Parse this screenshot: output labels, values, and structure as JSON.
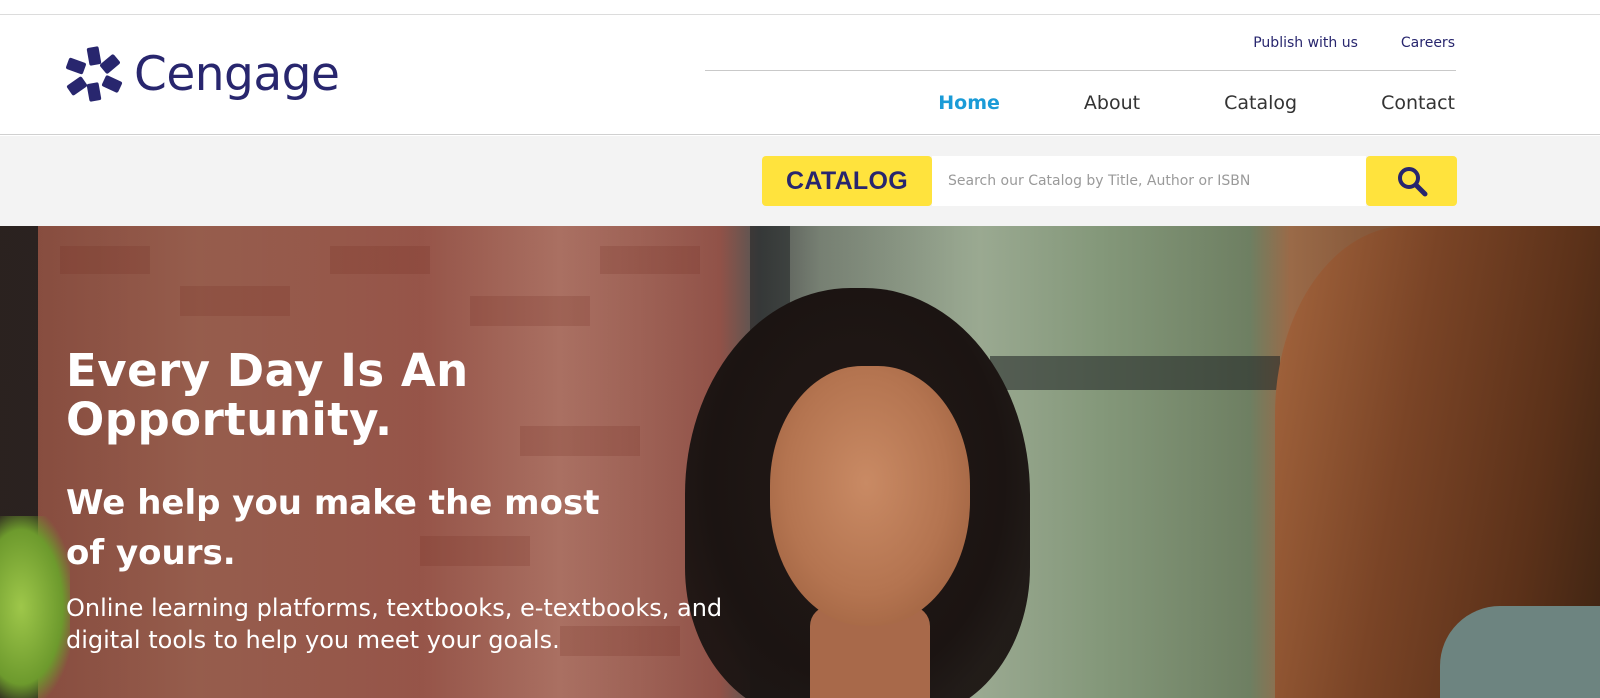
{
  "brand": {
    "name": "Cengage",
    "primary_color": "#28266e",
    "accent_color": "#ffe33d",
    "active_link_color": "#1a9bd7"
  },
  "utility_nav": [
    {
      "label": "Publish with us"
    },
    {
      "label": "Careers"
    }
  ],
  "main_nav": [
    {
      "label": "Home",
      "active": true
    },
    {
      "label": "About",
      "active": false
    },
    {
      "label": "Catalog",
      "active": false
    },
    {
      "label": "Contact",
      "active": false
    }
  ],
  "search": {
    "catalog_label": "CATALOG",
    "placeholder": "Search our Catalog by Title, Author or ISBN",
    "value": "",
    "button_icon": "search-icon"
  },
  "hero": {
    "title_line1": "Every Day Is An",
    "title_line2": "Opportunity.",
    "subtitle": "We help you make the most of yours.",
    "body": "Online learning platforms, textbooks, e-textbooks, and digital tools to help you meet your goals."
  }
}
